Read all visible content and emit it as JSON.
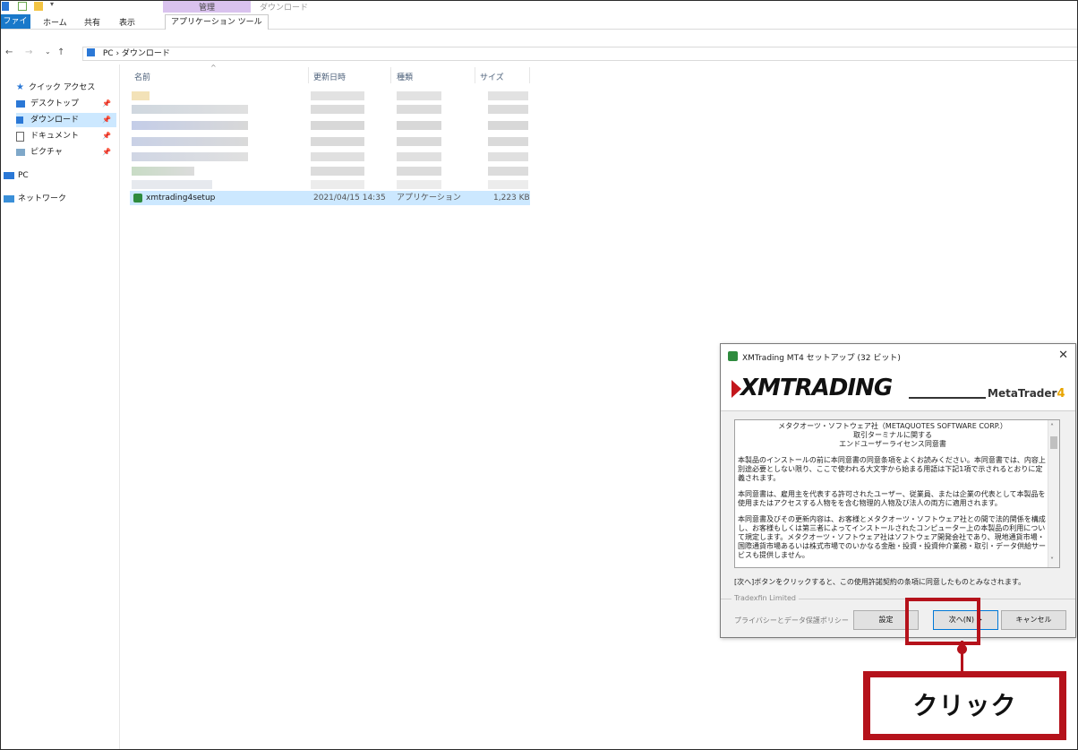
{
  "window": {
    "title": "ダウンロード"
  },
  "ribbon": {
    "context_group": "管理",
    "tabs": [
      "ファイル",
      "ホーム",
      "共有",
      "表示",
      "アプリケーション ツール"
    ]
  },
  "address": {
    "path": "PC  ›  ダウンロード"
  },
  "nav_pane": {
    "quick_access": "クイック アクセス",
    "items": [
      "デスクトップ",
      "ダウンロード",
      "ドキュメント",
      "ピクチャ"
    ],
    "pc": "PC",
    "network": "ネットワーク"
  },
  "columns": {
    "name": "名前",
    "date": "更新日時",
    "type": "種類",
    "size": "サイズ"
  },
  "selected_file": {
    "name": "xmtrading4setup",
    "date": "2021/04/15 14:35",
    "type": "アプリケーション",
    "size": "1,223 KB"
  },
  "dialog": {
    "title": "XMTrading MT4 セットアップ (32 ビット)",
    "close": "✕",
    "logo": "XMTRADING",
    "brand_word": "MetaTrader",
    "brand_num": "4",
    "license": {
      "heading1": "メタクオーツ・ソフトウェア社（METAQUOTES SOFTWARE CORP.）",
      "heading2": "取引ターミナルに関する",
      "heading3": "エンドユーザーライセンス同意書",
      "p1": "本製品のインストールの前に本同意書の同意条項をよくお読みください。本同意書では、内容上別途必要としない限り、ここで使われる大文字から始まる用語は下記1項で示されるとおりに定義されます。",
      "p2": "本同意書は、雇用主を代表する許可されたユーザー、従業員、または企業の代表として本製品を使用またはアクセスする人物をを含む物理的人物及び法人の両方に適用されます。",
      "p3": "本同意書及びその更新内容は、お客様とメタクオーツ・ソフトウェア社との間で法的関係を構成し、お客様もしくは第三者によってインストールされたコンピューター上の本製品の利用について規定します。メタクオーツ・ソフトウェア社はソフトウェア開発会社であり、現地通貨市場・国際通貨市場あるいは株式市場でのいかなる金融・投資・投資仲介業務・取引・データ供給サービスも提供しません。"
    },
    "agree_note": "[次へ]ボタンをクリックすると、この使用許諾契約の条項に同意したものとみなされます。",
    "group_label": "Tradexfin Limited",
    "privacy": "プライバシーとデータ保護ポリシー",
    "buttons": {
      "settings": "設定",
      "next": "次へ(N) >",
      "cancel": "キャンセル"
    }
  },
  "callout": {
    "text": "クリック"
  },
  "colors": {
    "accent": "#b5121b",
    "selection": "#cce8ff",
    "ribbon_file": "#1979ca"
  }
}
